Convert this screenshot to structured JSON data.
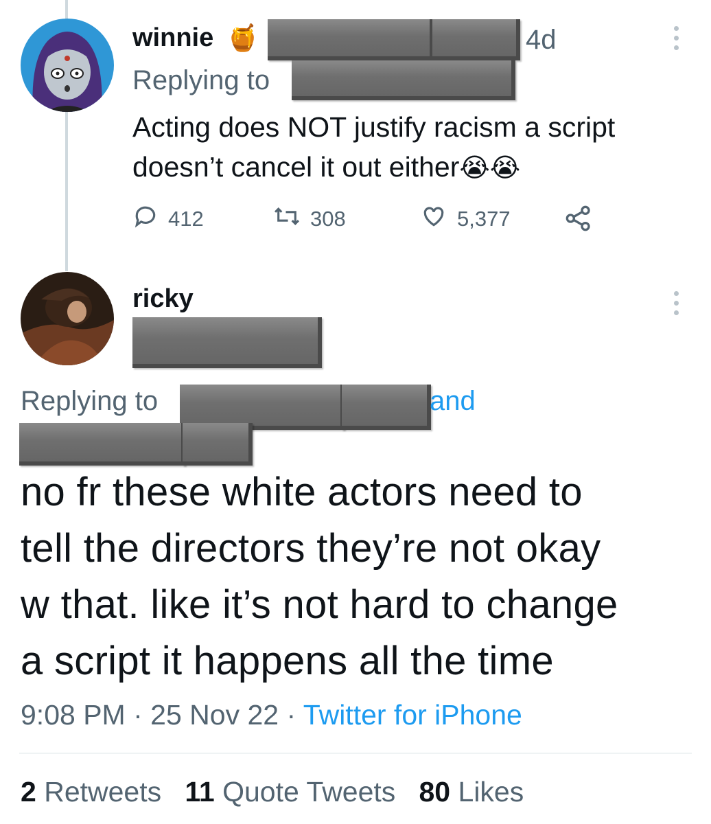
{
  "tweet1": {
    "username": "winnie",
    "name_emoji": "🍯",
    "time": "4d",
    "replying_label": "Replying to",
    "text_line1": "Acting does NOT justify racism a script",
    "text_line2": "doesn’t cancel it out either",
    "text_emoji": "😭😭",
    "reply_count": "412",
    "retweet_count": "308",
    "like_count": "5,377"
  },
  "tweet2": {
    "username": "ricky",
    "replying_label": "Replying to",
    "and_label": "and",
    "text_lines": [
      "no fr these white actors need to",
      "tell the directors they’re not okay",
      "w that. like it’s not hard to change",
      "a script it happens all the time"
    ],
    "time": "9:08 PM",
    "date": "25 Nov 22",
    "separator": "·",
    "source": "Twitter for iPhone",
    "retweets_count": "2",
    "retweets_label": "Retweets",
    "quotes_count": "11",
    "quotes_label": "Quote Tweets",
    "likes_count": "80",
    "likes_label": "Likes"
  },
  "icons": {
    "reply": "reply-icon",
    "retweet": "retweet-icon",
    "like": "heart-icon",
    "share": "share-icon",
    "more": "more-options-icon"
  },
  "colors": {
    "link": "#1d9bf0",
    "muted": "#536471",
    "thread_line": "#cfd9de"
  }
}
